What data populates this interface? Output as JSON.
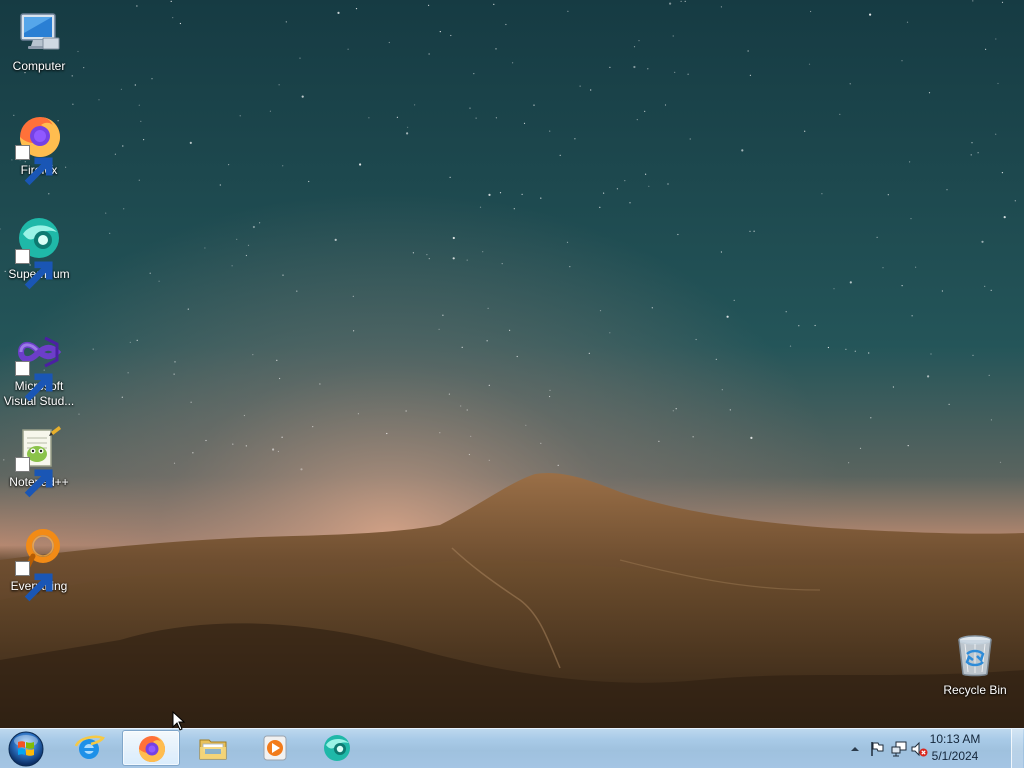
{
  "desktop": {
    "icons": [
      {
        "label": "Computer",
        "icon": "computer-icon"
      },
      {
        "label": "Firefox",
        "icon": "firefox-icon"
      },
      {
        "label": "Supermium",
        "icon": "supermium-icon"
      },
      {
        "label": "Microsoft\nVisual Stud...",
        "icon": "visual-studio-icon"
      },
      {
        "label": "Notepad++",
        "icon": "notepadplusplus-icon"
      },
      {
        "label": "Everything",
        "icon": "everything-icon"
      },
      {
        "label": "Recycle Bin",
        "icon": "recycle-bin-icon"
      }
    ]
  },
  "taskbar": {
    "start_icon": "windows-start-icon",
    "pinned": [
      {
        "icon": "internet-explorer-icon",
        "active": false
      },
      {
        "icon": "firefox-icon",
        "active": true
      },
      {
        "icon": "file-explorer-icon",
        "active": false
      },
      {
        "icon": "media-player-icon",
        "active": false
      },
      {
        "icon": "supermium-icon",
        "active": false
      }
    ],
    "tray": {
      "icons": [
        "show-hidden-icons-icon",
        "action-center-flag-icon",
        "network-icon",
        "volume-muted-icon"
      ],
      "time": "10:13 AM",
      "date": "5/1/2024"
    }
  },
  "colors": {
    "sky_top": "#163b43",
    "sky_mid": "#275a5d",
    "horizon_glow": "#b9876d",
    "mountain": "#5d4126",
    "taskbar": "#a9cbe8",
    "clock_text": "#14263a"
  }
}
